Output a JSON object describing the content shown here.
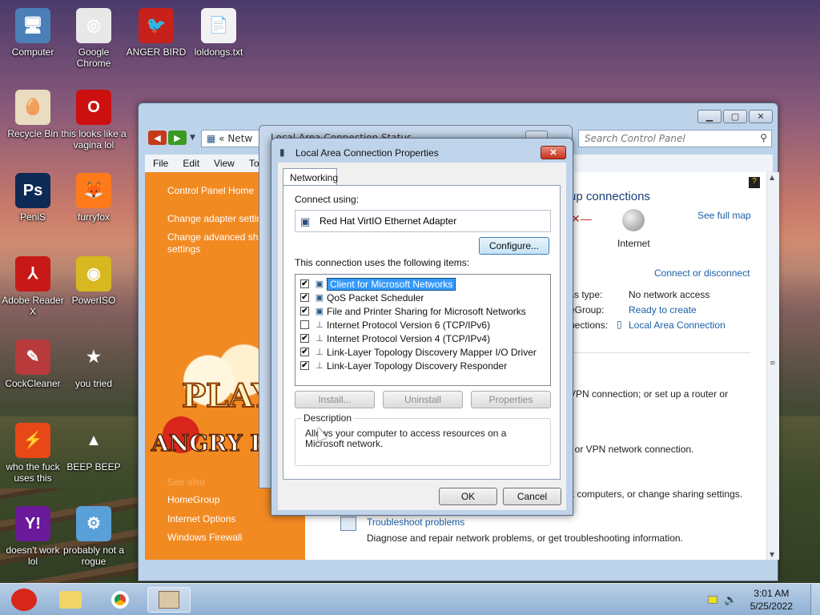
{
  "desktop": {
    "icons": [
      {
        "label": "Computer",
        "glyph": "🖥",
        "bg": "#4a7fb8"
      },
      {
        "label": "Google Chrome",
        "glyph": "◎",
        "bg": "#e8e8e8"
      },
      {
        "label": "ANGER BIRD",
        "glyph": "🐦",
        "bg": "#c8201a"
      },
      {
        "label": "loldongs.txt",
        "glyph": "📄",
        "bg": "#f2f2f2"
      },
      {
        "label": "Recycle Bin",
        "glyph": "🥚",
        "bg": "#e9dcc0"
      },
      {
        "label": "this looks like a vagina lol",
        "glyph": "O",
        "bg": "#cc1010"
      },
      {
        "label": "PeniS",
        "glyph": "Ps",
        "bg": "#0d2a55"
      },
      {
        "label": "furryfox",
        "glyph": "🦊",
        "bg": "#ff7a1a"
      },
      {
        "label": "Adobe Reader X",
        "glyph": "⅄",
        "bg": "#c81818"
      },
      {
        "label": "PowerISO",
        "glyph": "◉",
        "bg": "#d8b820"
      },
      {
        "label": "CockCleaner",
        "glyph": "✎",
        "bg": "#b83a3a"
      },
      {
        "label": "you tried",
        "glyph": "★",
        "bg": "transparent"
      },
      {
        "label": "who the fuck uses this",
        "glyph": "⚡",
        "bg": "#e84818"
      },
      {
        "label": "BEEP BEEP",
        "glyph": "▲",
        "bg": "transparent"
      },
      {
        "label": "doesn't work lol",
        "glyph": "Y!",
        "bg": "#6a1a9a"
      },
      {
        "label": "probably not a rogue",
        "glyph": "⚙",
        "bg": "#5aa0d8"
      }
    ]
  },
  "control_panel": {
    "address_text": "« Netw",
    "search_placeholder": "Search Control Panel",
    "menu": [
      "File",
      "Edit",
      "View",
      "Too"
    ],
    "sidebar": {
      "home": "Control Panel Home",
      "change_adapter": "Change adapter settin",
      "change_advanced": "Change advanced sha",
      "change_advanced_2": "settings",
      "see_also": "See also",
      "homegroup": "HomeGroup",
      "internet_options": "Internet Options",
      "windows_firewall": "Windows Firewall",
      "play": "PLAY",
      "angry_birds": "ANGRY BI"
    },
    "main": {
      "heading": "up connections",
      "see_full_map": "See full map",
      "internet": "Internet",
      "connect_disconnect": "Connect or disconnect",
      "access_type_label": "ss type:",
      "access_type_value": "No network access",
      "homegroup_label": "eGroup:",
      "homegroup_value": "Ready to create",
      "connections_label": "nections:",
      "connections_value": "Local Area Connection",
      "setup_text": "VPN connection; or set up a router or",
      "vpn_text": ", or VPN network connection.",
      "sharing_text": "k computers, or change sharing settings.",
      "troubleshoot_title": "Troubleshoot problems",
      "troubleshoot_desc": "Diagnose and repair network problems, or get troubleshooting information."
    }
  },
  "status_dialog": {
    "title": "Local Area Connection Status"
  },
  "properties_dialog": {
    "title": "Local Area Connection Properties",
    "close": "✕",
    "tab": "Networking",
    "connect_using_label": "Connect using:",
    "adapter": "Red Hat VirtIO Ethernet Adapter",
    "configure": "Configure...",
    "items_label": "This connection uses the following items:",
    "items": [
      {
        "label": "Client for Microsoft Networks",
        "checked": "✔",
        "selected": true,
        "icon": "▣"
      },
      {
        "label": "QoS Packet Scheduler",
        "checked": "✔",
        "selected": false,
        "icon": "▣"
      },
      {
        "label": "File and Printer Sharing for Microsoft Networks",
        "checked": "✔",
        "selected": false,
        "icon": "▣"
      },
      {
        "label": "Internet Protocol Version 6 (TCP/IPv6)",
        "checked": "",
        "selected": false,
        "icon": "⊥"
      },
      {
        "label": "Internet Protocol Version 4 (TCP/IPv4)",
        "checked": "✔",
        "selected": false,
        "icon": "⊥"
      },
      {
        "label": "Link-Layer Topology Discovery Mapper I/O Driver",
        "checked": "✔",
        "selected": false,
        "icon": "⊥"
      },
      {
        "label": "Link-Layer Topology Discovery Responder",
        "checked": "✔",
        "selected": false,
        "icon": "⊥"
      }
    ],
    "install": "Install...",
    "uninstall": "Uninstall",
    "properties": "Properties",
    "description_label": "Description",
    "description": "Allows your computer to access resources on a Microsoft network.",
    "ok": "OK",
    "cancel": "Cancel"
  },
  "taskbar": {
    "time": "3:01 AM",
    "date": "5/25/2022"
  }
}
